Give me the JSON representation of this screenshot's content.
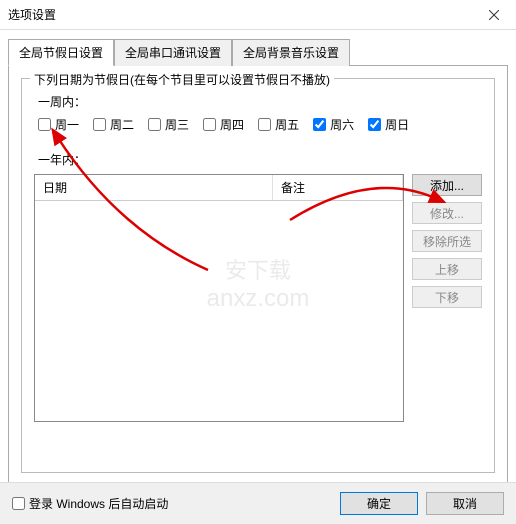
{
  "window": {
    "title": "选项设置"
  },
  "tabs": {
    "t1": "全局节假日设置",
    "t2": "全局串口通讯设置",
    "t3": "全局背景音乐设置"
  },
  "group": {
    "title": "下列日期为节假日(在每个节目里可以设置节假日不播放)"
  },
  "week": {
    "label": "一周内：",
    "d1": "周一",
    "d2": "周二",
    "d3": "周三",
    "d4": "周四",
    "d5": "周五",
    "d6": "周六",
    "d7": "周日",
    "checked": {
      "d1": false,
      "d2": false,
      "d3": false,
      "d4": false,
      "d5": false,
      "d6": true,
      "d7": true
    }
  },
  "year": {
    "label": "一年内："
  },
  "table": {
    "col1": "日期",
    "col2": "备注"
  },
  "buttons": {
    "add": "添加...",
    "edit": "修改...",
    "remove": "移除所选",
    "up": "上移",
    "down": "下移"
  },
  "bottom": {
    "autostart": "登录 Windows 后自动启动",
    "ok": "确定",
    "cancel": "取消"
  },
  "watermark": {
    "l1": "安下载",
    "l2": "anxz.com"
  }
}
